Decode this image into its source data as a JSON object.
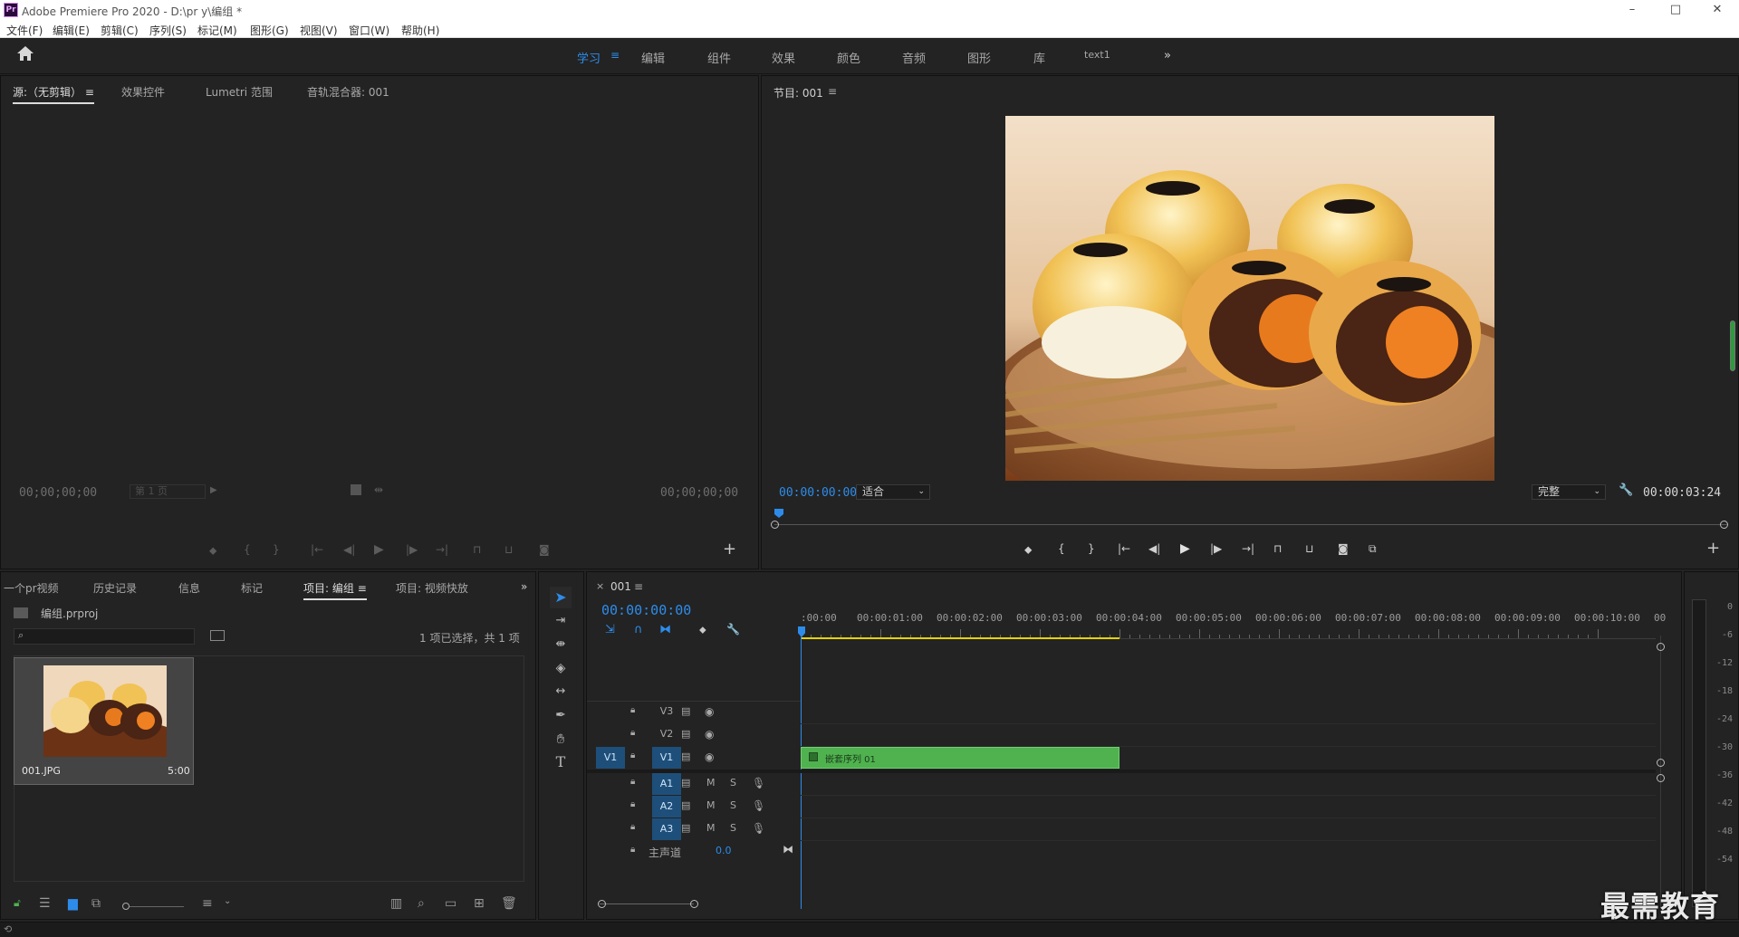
{
  "titlebar": {
    "title": "Adobe Premiere Pro 2020 - D:\\pr y\\编组 *",
    "logo": "Pr",
    "minimize": "–",
    "maximize": "□",
    "close": "✕"
  },
  "menus": [
    "文件(F)",
    "编辑(E)",
    "剪辑(C)",
    "序列(S)",
    "标记(M)",
    "图形(G)",
    "视图(V)",
    "窗口(W)",
    "帮助(H)"
  ],
  "workspaces": {
    "items": [
      "学习",
      "编辑",
      "组件",
      "效果",
      "颜色",
      "音频",
      "图形",
      "库",
      "text1"
    ],
    "active": "学习",
    "active_menu_glyph": "≡",
    "overflow_glyph": "»"
  },
  "source_panel": {
    "tabs": [
      "源:（无剪辑）",
      "效果控件",
      "Lumetri 范围",
      "音轨混合器: 001"
    ],
    "tab_menu_glyph": "≡",
    "timecode_left": "00;00;00;00",
    "timecode_right": "00;00;00;00",
    "page_select": "第 1 页",
    "add_glyph": "+"
  },
  "program_panel": {
    "title": "节目: 001",
    "title_menu_glyph": "≡",
    "timecode": "00:00:00:00",
    "fit": "适合",
    "quality": "完整",
    "duration": "00:00:03:24",
    "add_glyph": "+"
  },
  "project_panel": {
    "tabs": [
      "一个pr视频",
      "历史记录",
      "信息",
      "标记",
      "项目: 编组",
      "项目: 视频快放"
    ],
    "active_tab": "项目: 编组",
    "tab_menu_glyph": "≡",
    "overflow_glyph": "»",
    "project_file": "编组.prproj",
    "selection_status": "1 项已选择，共 1 项",
    "item": {
      "name": "001.JPG",
      "duration": "5:00"
    }
  },
  "timeline": {
    "sequence_tab": "001",
    "close_glyph": "×",
    "tab_menu_glyph": "≡",
    "timecode": "00:00:00:00",
    "ruler": [
      ":00:00",
      "00:00:01:00",
      "00:00:02:00",
      "00:00:03:00",
      "00:00:04:00",
      "00:00:05:00",
      "00:00:06:00",
      "00:00:07:00",
      "00:00:08:00",
      "00:00:09:00",
      "00:00:10:00",
      "00"
    ],
    "video_tracks": [
      "V3",
      "V2",
      "V1"
    ],
    "audio_tracks": [
      "A1",
      "A2",
      "A3"
    ],
    "source_patch": "V1",
    "mute_label": "M",
    "solo_label": "S",
    "master_label": "主声道",
    "master_value": "0.0",
    "clip_label": "嵌套序列 01",
    "clip_end_seconds": 4.0
  },
  "audio_meter": {
    "labels": [
      "0",
      "-6",
      "-12",
      "-18",
      "-24",
      "-30",
      "-36",
      "-42",
      "-48",
      "-54"
    ]
  },
  "watermark": "最需教育",
  "colors": {
    "accent": "#2d8ceb",
    "clip_green": "#4fb24f",
    "work_area": "#e6d200",
    "track_badge": "#1e4f7a"
  }
}
